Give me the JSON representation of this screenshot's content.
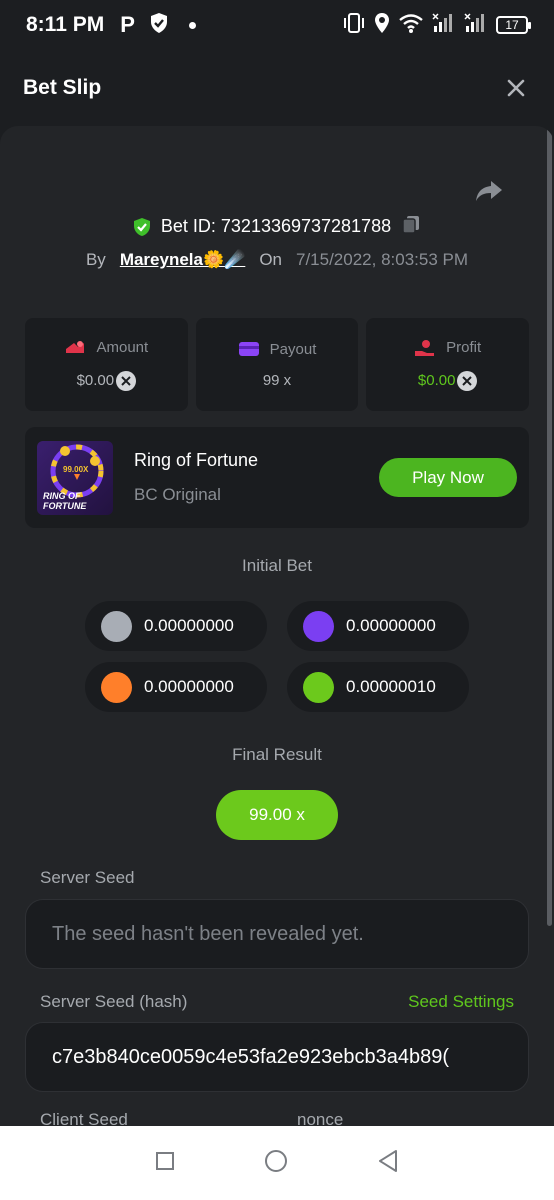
{
  "status_bar": {
    "time": "8:11 PM",
    "battery": "17",
    "icons": [
      "parking-p-icon",
      "shield-check-icon",
      "dot-icon",
      "vibrate-icon",
      "location-icon",
      "wifi-icon",
      "signal-icon",
      "signal-icon"
    ]
  },
  "header": {
    "title": "Bet Slip",
    "close_icon": "close-icon"
  },
  "bet": {
    "id_text": "Bet ID: 73213369737281788",
    "by_label": "By",
    "username": "Mareynela🌼☄️",
    "on_label": "On",
    "date": "7/15/2022, 8:03:53 PM"
  },
  "stats": {
    "amount": {
      "label": "Amount",
      "value": "$0.00"
    },
    "payout": {
      "label": "Payout",
      "value": "99 x"
    },
    "profit": {
      "label": "Profit",
      "value": "$0.00"
    }
  },
  "game": {
    "name": "Ring of Fortune",
    "provider": "BC Original",
    "play_label": "Play Now",
    "thumb_text_multiplier": "99.00X",
    "thumb_text_title": "RING OF",
    "thumb_text_title2": "FORTUNE"
  },
  "initial_bet": {
    "label": "Initial Bet",
    "bets": [
      {
        "color": "#a8adb5",
        "value": "0.00000000"
      },
      {
        "color": "#7b3ff2",
        "value": "0.00000000"
      },
      {
        "color": "#ff7f2a",
        "value": "0.00000000"
      },
      {
        "color": "#6cc91c",
        "value": "0.00000010"
      }
    ]
  },
  "final_result": {
    "label": "Final Result",
    "value": "99.00 x"
  },
  "seeds": {
    "server_seed_label": "Server Seed",
    "server_seed_value": "The seed hasn't been revealed yet.",
    "server_hash_label": "Server Seed (hash)",
    "seed_settings_label": "Seed Settings",
    "server_hash_value": "c7e3b840ce0059c4e53fa2e923ebcb3a4b89(",
    "client_seed_label": "Client Seed",
    "nonce_label": "nonce"
  },
  "colors": {
    "accent_green": "#5fc71d",
    "background": "#1c1e21",
    "panel": "#232528"
  }
}
